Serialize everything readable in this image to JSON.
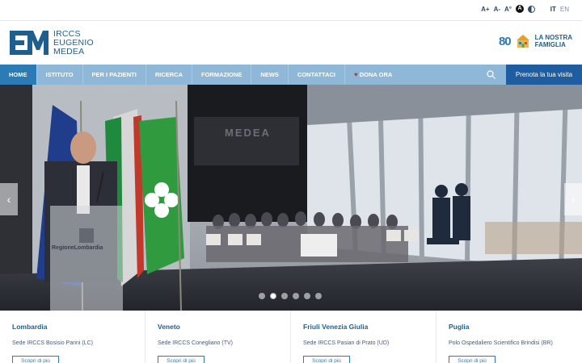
{
  "a11y": {
    "font_increase": "A+",
    "font_decrease": "A-",
    "font_reset": "A°",
    "contrast_high": "A"
  },
  "lang": {
    "active": "IT",
    "other": "EN"
  },
  "brand": {
    "line1": "IRCCS",
    "line2": "EUGENIO",
    "line3": "MEDEA",
    "color": "#1e5f8f"
  },
  "partner": {
    "eighty": "80",
    "line1": "LA NOSTRA",
    "line2": "FAMIGLIA"
  },
  "nav": {
    "items": [
      "HOME",
      "ISTITUTO",
      "PER I PAZIENTI",
      "RICERCA",
      "FORMAZIONE",
      "NEWS",
      "CONTATTACI",
      "DONA ORA"
    ],
    "active": "HOME",
    "book_label": "Prenota la tua visita"
  },
  "hero": {
    "podium_text": "RegioneLombardia",
    "banner_text": "MEDEA",
    "slides": 6,
    "active_slide": 2
  },
  "regions": [
    {
      "name": "Lombardia",
      "site": "Sede IRCCS Bosisio Parini (LC)",
      "button": "Scopri di più"
    },
    {
      "name": "Veneto",
      "site": "Sede IRCCS Conegliano (TV)",
      "button": "Scopri di più"
    },
    {
      "name": "Friuli Venezia Giulia",
      "site": "Sede IRCCS Pasian di Prato (UD)",
      "button": "Scopri di più"
    },
    {
      "name": "Puglia",
      "site": "Polo Ospedaliero Scientifico Brindisi (BR)",
      "button": "Scopri di più"
    }
  ],
  "colors": {
    "nav_bg": "#8eb7d8",
    "nav_active": "#2b7cb4",
    "book_bg": "#1e5da0",
    "accent": "#1e5f8f"
  }
}
